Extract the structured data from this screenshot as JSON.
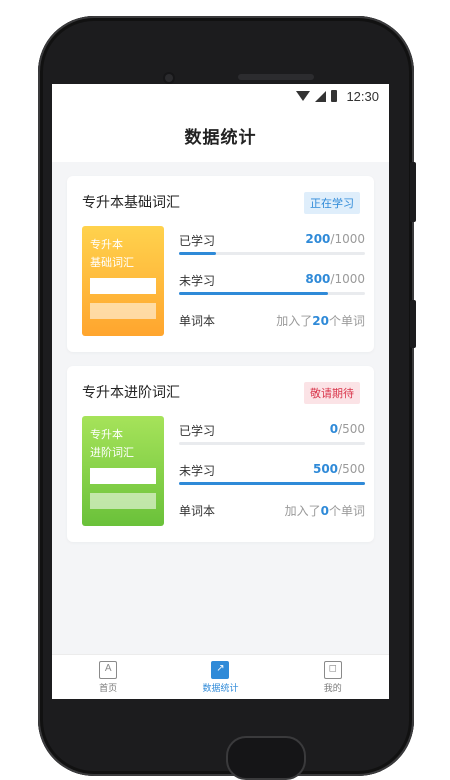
{
  "status_bar": {
    "time": "12:30"
  },
  "header": {
    "title": "数据统计"
  },
  "cards": [
    {
      "title": "专升本基础词汇",
      "badge": "正在学习",
      "badge_color": "#2f8ad8",
      "book_label_line1": "专升本",
      "book_label_line2": "基础词汇",
      "book_color": "#ffa52e",
      "learned_label": "已学习",
      "learned_value": "200",
      "learned_total": "/1000",
      "learned_progress": 0.2,
      "unlearned_label": "未学习",
      "unlearned_value": "800",
      "unlearned_total": "/1000",
      "unlearned_progress": 0.8,
      "wordbook_label": "单词本",
      "wordbook_prefix": "加入了",
      "wordbook_count": "20",
      "wordbook_suffix": "个单词"
    },
    {
      "title": "专升本进阶词汇",
      "badge": "敬请期待",
      "badge_color": "#d9374c",
      "book_label_line1": "专升本",
      "book_label_line2": "进阶词汇",
      "book_color": "#6ac13a",
      "learned_label": "已学习",
      "learned_value": "0",
      "learned_total": "/500",
      "learned_progress": 0.0,
      "unlearned_label": "未学习",
      "unlearned_value": "500",
      "unlearned_total": "/500",
      "unlearned_progress": 1.0,
      "wordbook_label": "单词本",
      "wordbook_prefix": "加入了",
      "wordbook_count": "0",
      "wordbook_suffix": "个单词"
    }
  ],
  "tabbar": {
    "items": [
      {
        "label": "首页",
        "icon": "home-icon",
        "glyph": "A",
        "active": false
      },
      {
        "label": "数据统计",
        "icon": "chart-icon",
        "glyph": "↗",
        "active": true
      },
      {
        "label": "我的",
        "icon": "profile-icon",
        "glyph": "◻",
        "active": false
      }
    ]
  },
  "colors": {
    "accent": "#2f8ad8",
    "background": "#f4f5f7"
  }
}
